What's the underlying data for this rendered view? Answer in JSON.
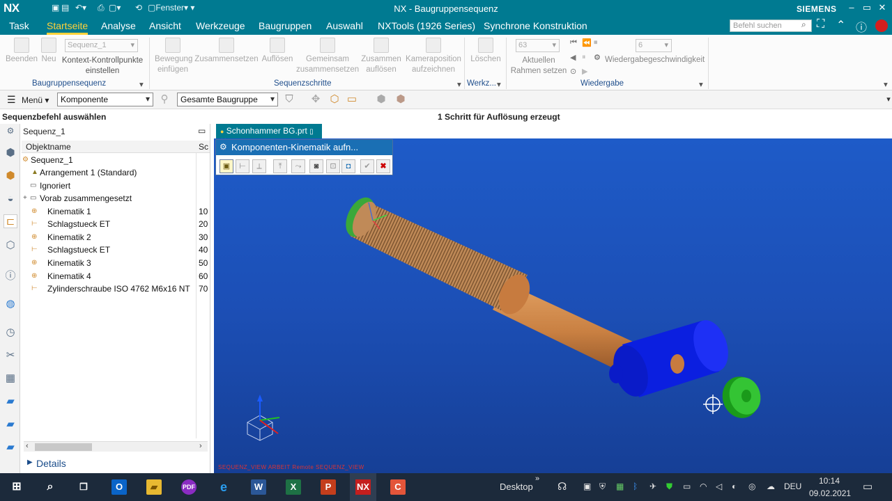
{
  "titlebar": {
    "logo": "NX",
    "window_menu": "Fenster",
    "title": "NX - Baugruppensequenz",
    "brand": "SIEMENS"
  },
  "menubar": {
    "tabs": [
      "Task",
      "Startseite",
      "Analyse",
      "Ansicht",
      "Werkzeuge",
      "Baugruppen",
      "Auswahl",
      "NXTools (1926 Series)",
      "Synchrone Konstruktion"
    ],
    "active_tab": "Startseite",
    "search_placeholder": "Befehl suchen"
  },
  "ribbon": {
    "baugruppensequenz": {
      "group_label": "Baugruppensequenz",
      "beenden": "Beenden",
      "neu": "Neu",
      "sequence_select": "Sequenz_1",
      "kontext_line1": "Kontext-Kontrollpunkte",
      "kontext_line2": "einstellen"
    },
    "sequenzschritte": {
      "group_label": "Sequenzschritte",
      "bewegung_line1": "Bewegung",
      "bewegung_line2": "einfügen",
      "zusammensetzen": "Zusammensetzen",
      "aufloesen": "Auflösen",
      "gemeinsam_line1": "Gemeinsam",
      "gemeinsam_line2": "zusammensetzen",
      "zusammen_line1": "Zusammen",
      "zusammen_line2": "auflösen",
      "kamera_line1": "Kameraposition",
      "kamera_line2": "aufzeichnen"
    },
    "werkzeuge": {
      "group_label": "Werkz...",
      "loeschen": "Löschen"
    },
    "wiedergabe": {
      "group_label": "Wiedergabe",
      "frame_select": "63",
      "aktuellen_line1": "Aktuellen",
      "aktuellen_line2": "Rahmen setzen",
      "speed_select": "6",
      "speed_label": "Wiedergabegeschwindigkeit"
    }
  },
  "toolbar2": {
    "menu_label": "Menü",
    "filter_select": "Komponente",
    "scope_select": "Gesamte Baugruppe"
  },
  "status": {
    "left": "Sequenzbefehl auswählen",
    "center": "1 Schritt für Auflösung erzeugt"
  },
  "navigator": {
    "title": "Sequenz_1",
    "col_name": "Objektname",
    "col_step": "Sc",
    "items": [
      {
        "label": "Sequenz_1",
        "step": ""
      },
      {
        "label": "Arrangement 1 (Standard)",
        "step": ""
      },
      {
        "label": "Ignoriert",
        "step": ""
      },
      {
        "label": "Vorab zusammengesetzt",
        "step": ""
      },
      {
        "label": "Kinematik 1",
        "step": "10"
      },
      {
        "label": "Schlagstueck ET",
        "step": "20"
      },
      {
        "label": "Kinematik 2",
        "step": "30"
      },
      {
        "label": "Schlagstueck ET",
        "step": "40"
      },
      {
        "label": "Kinematik 3",
        "step": "50"
      },
      {
        "label": "Kinematik 4",
        "step": "60"
      },
      {
        "label": "Zylinderschraube ISO 4762 M6x16 NT",
        "step": "70"
      }
    ],
    "details_label": "Details"
  },
  "document_tab": {
    "label": "Schonhammer BG.prt"
  },
  "dialog": {
    "title": "Komponenten-Kinematik aufn..."
  },
  "viewport": {
    "footer_text": "SEQUENZ_VIEW ARBEIT Remote SEQUENZ_VIEW"
  },
  "taskbar": {
    "desktop_label": "Desktop",
    "language": "DEU",
    "time": "10:14",
    "date": "09.02.2021"
  },
  "colors": {
    "titlebar": "#007a91",
    "active_tab": "#ffd23a",
    "viewport_bg": "#1c4fb6",
    "taskbar": "#1c2a3b"
  }
}
